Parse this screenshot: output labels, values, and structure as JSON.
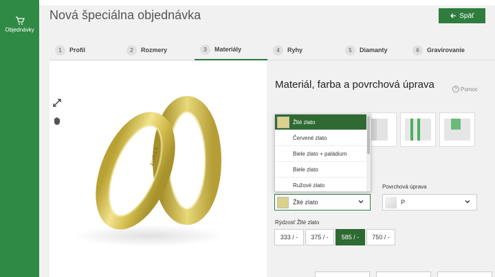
{
  "sidebar": {
    "orders_label": "Objednávky"
  },
  "page": {
    "title": "Nová špeciálna objednávka",
    "back_label": "Späť"
  },
  "steps": [
    {
      "num": "1",
      "label": "Profil"
    },
    {
      "num": "2",
      "label": "Rozmery"
    },
    {
      "num": "3",
      "label": "Materiály"
    },
    {
      "num": "4",
      "label": "Ryhy"
    },
    {
      "num": "5",
      "label": "Diamanty"
    },
    {
      "num": "6",
      "label": "Gravirovanie"
    }
  ],
  "active_step": "3",
  "panel": {
    "title": "Materiál, farba a povrchová úprava",
    "help_label": "Pomoc"
  },
  "ring_engraving": "AURES",
  "material_dropdown": {
    "options": [
      "Žlté zlato",
      "Červené zlato",
      "Biele zlato + paládium",
      "Biele zlato",
      "Ružové zlato"
    ],
    "selected": "Žlté zlato"
  },
  "material_select": {
    "value": "Žlté zlato"
  },
  "surface": {
    "label": "Povrchová úprava",
    "value": "P"
  },
  "fineness": {
    "label": "Rýdzosť Žlté zlato",
    "options": [
      "333 / -",
      "375 / -",
      "585 / -",
      "750 / -"
    ],
    "selected": "585 / -"
  },
  "colors": {
    "accent": "#2e7d3e",
    "sidebar": "#2f8a45",
    "gold": "#ddd08a"
  }
}
